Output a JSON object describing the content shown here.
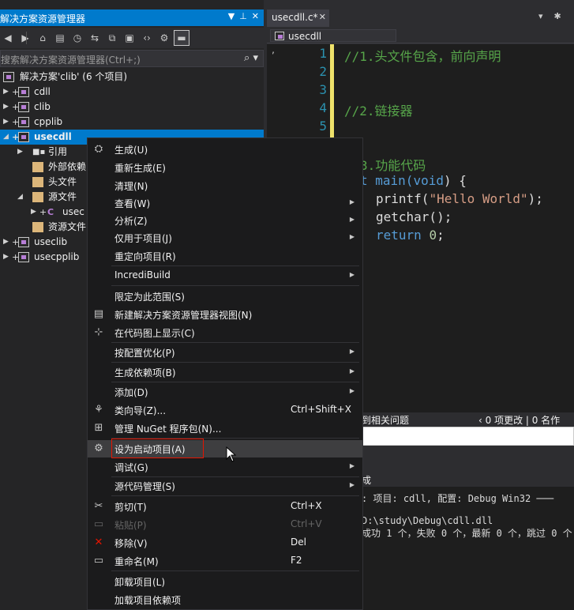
{
  "solution_explorer": {
    "title": "解决方案资源管理器",
    "search_placeholder": "搜索解决方案资源管理器(Ctrl+;)",
    "solution_label": "解决方案'clib' (6 个项目)",
    "projects": [
      "cdll",
      "clib",
      "cpplib",
      "usecdll",
      "useclib",
      "usecpplib"
    ],
    "children": [
      "引用",
      "外部依赖",
      "头文件",
      "源文件",
      "usec",
      "资源文件"
    ],
    "file_prefix": "C"
  },
  "editor": {
    "tab_title": "usecdll.c*",
    "nav_project": "usecdll",
    "line_numbers": [
      "1",
      "2",
      "3",
      "4",
      "5"
    ],
    "comment1": "//1.头文件包含，前向声明",
    "comment2": "//2.链接器",
    "comment3": "3.功能代码",
    "line_main_a": "t main(",
    "line_main_b": "void",
    "line_main_c": ") {",
    "printf_a": "printf(",
    "printf_b": "\"Hello World\"",
    "printf_c": ");",
    "getchar": "getchar();",
    "ret_kw": "return",
    "ret_val": "0",
    "ret_end": ";"
  },
  "error_list": {
    "left": "到相关问题",
    "right": "‹ 0 项更改 | 0 名作"
  },
  "output": {
    "title": "成",
    "line1": "෻: 项目: cdll, 配置: Debug Win32 ───",
    "line2": "D:\\study\\Debug\\cdll.dll",
    "line3": "成功 1 个，失败 0 个，最新 0 个，跳过 0 个 ══"
  },
  "context_menu": {
    "items": [
      {
        "label": "生成(U)",
        "icon": "build-icon"
      },
      {
        "label": "重新生成(E)"
      },
      {
        "label": "清理(N)"
      },
      {
        "label": "查看(W)"
      },
      {
        "label": "分析(Z)"
      },
      {
        "label": "仅用于项目(J)"
      },
      {
        "label": "重定向项目(R)"
      },
      {
        "label": "IncrediBuild"
      },
      {
        "label": "限定为此范围(S)"
      },
      {
        "label": "新建解决方案资源管理器视图(N)"
      },
      {
        "label": "在代码图上显示(C)"
      },
      {
        "label": "按配置优化(P)"
      },
      {
        "label": "生成依赖项(B)"
      },
      {
        "label": "添加(D)"
      },
      {
        "label": "类向导(Z)...",
        "shortcut": "Ctrl+Shift+X"
      },
      {
        "label": "管理 NuGet 程序包(N)..."
      },
      {
        "label": "设为启动项目(A)"
      },
      {
        "label": "调试(G)"
      },
      {
        "label": "源代码管理(S)"
      },
      {
        "label": "剪切(T)",
        "shortcut": "Ctrl+X"
      },
      {
        "label": "粘贴(P)",
        "shortcut": "Ctrl+V"
      },
      {
        "label": "移除(V)",
        "shortcut": "Del"
      },
      {
        "label": "重命名(M)",
        "shortcut": "F2"
      },
      {
        "label": "卸载项目(L)"
      },
      {
        "label": "加载项目依赖项"
      }
    ]
  },
  "colors": {
    "accent": "#007acc",
    "highlight_box": "#e51400",
    "comment": "#57a64a",
    "keyword": "#569cd6",
    "string": "#d69d85"
  }
}
